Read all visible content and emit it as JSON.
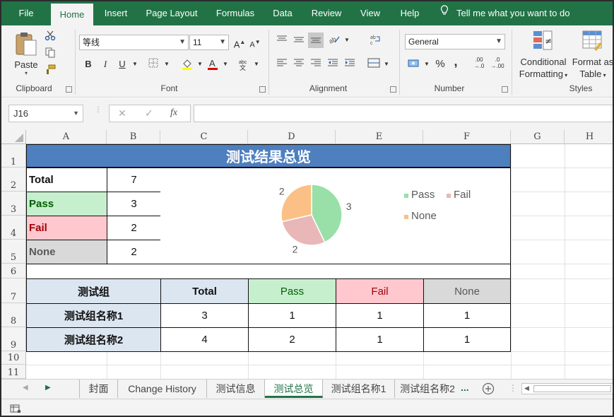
{
  "ribbon_tabs": [
    "File",
    "Home",
    "Insert",
    "Page Layout",
    "Formulas",
    "Data",
    "Review",
    "View",
    "Help"
  ],
  "tell_me": "Tell me what you want to do",
  "clipboard": {
    "paste": "Paste",
    "label": "Clipboard"
  },
  "font": {
    "name": "等线",
    "size": "11",
    "label": "Font",
    "bold": "B",
    "italic": "I",
    "underline": "U"
  },
  "alignment": {
    "label": "Alignment"
  },
  "number": {
    "format": "General",
    "percent": "%",
    "comma": ",",
    "label": "Number",
    "inc": ".00 →.0",
    "dec": ".0 →.00"
  },
  "styles": {
    "conditional": [
      "Conditional",
      "Formatting"
    ],
    "format_table": [
      "Format as",
      "Table"
    ],
    "label": "Styles"
  },
  "name_box": "J16",
  "fx": "fx",
  "columns": [
    "A",
    "B",
    "C",
    "D",
    "E",
    "F",
    "G",
    "H"
  ],
  "rows": [
    "1",
    "2",
    "3",
    "4",
    "5",
    "6",
    "7",
    "8",
    "9",
    "10",
    "11"
  ],
  "sheet": {
    "title": "测试结果总览",
    "summary": [
      {
        "label": "Total",
        "value": "7"
      },
      {
        "label": "Pass",
        "value": "3"
      },
      {
        "label": "Fail",
        "value": "2"
      },
      {
        "label": "None",
        "value": "2"
      }
    ],
    "table_header": [
      "测试组",
      "Total",
      "Pass",
      "Fail",
      "None"
    ],
    "table_rows": [
      [
        "测试组名称1",
        "3",
        "1",
        "1",
        "1"
      ],
      [
        "测试组名称2",
        "4",
        "2",
        "1",
        "1"
      ]
    ]
  },
  "chart_data": {
    "type": "pie",
    "categories": [
      "Pass",
      "Fail",
      "None"
    ],
    "values": [
      3,
      2,
      2
    ],
    "data_labels": [
      "3",
      "2",
      "2"
    ],
    "colors": [
      "#98e0a8",
      "#e9b7b7",
      "#fbc085"
    ],
    "legend_position": "right"
  },
  "colors": {
    "excel_green": "#217346",
    "title_blue": "#4e7fbf",
    "pass_bg": "#c6efce",
    "pass_text": "#006100",
    "fail_bg": "#ffc7ce",
    "fail_text": "#9c0006",
    "none_bg": "#d9d9d9",
    "none_text": "#595959",
    "group_bg": "#dce6f1"
  },
  "sheet_tabs": [
    "封面",
    "Change History",
    "测试信息",
    "测试总览",
    "测试组名称1",
    "测试组名称2"
  ],
  "active_sheet": "测试总览",
  "more_tabs": "..."
}
